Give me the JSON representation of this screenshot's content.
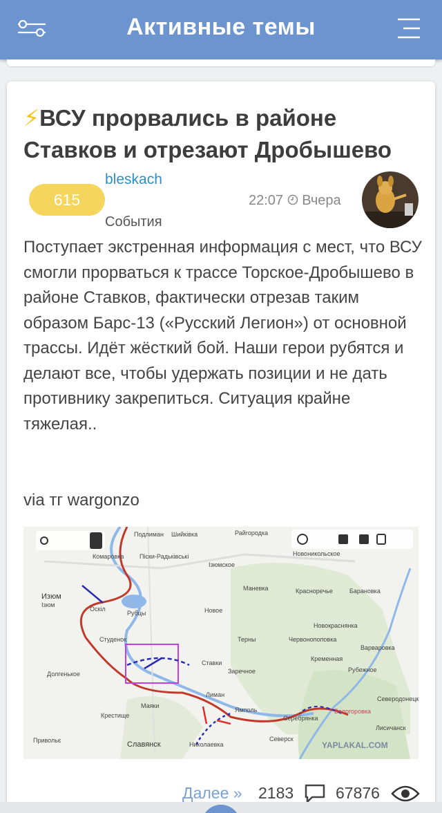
{
  "header": {
    "title": "Активные темы",
    "filter_icon": "filter-sliders-icon",
    "menu_icon": "hamburger-menu-icon"
  },
  "post": {
    "title_icon": "⚡",
    "title": "ВСУ прорвались в районе Ставков и отрезают Дробышево",
    "rating": "615",
    "author": "bleskach",
    "category": "События",
    "time": "22:07",
    "date": "Вчера",
    "body": "Поступает экстренная информация с мест, что ВСУ смогли прорваться к трассе Торское-Дробышево в районе Ставков, фактически отрезав таким образом Барс-13 («Русский Легион») от основной трассы. Идёт жёсткий бой. Наши герои рубятся и делают все, чтобы удержать позиции и не дать противнику закрепиться. Ситуация крайне тяжелая..",
    "via": "via тг wargonzo",
    "map": {
      "labels": [
        "Подлиман",
        "Шийківка",
        "Райгородка",
        "Комаровка",
        "Піски-Радьківські",
        "Ізюмское",
        "Новоникольское",
        "Изюм",
        "Ізюм",
        "Оскіл",
        "Рубцы",
        "Маневка",
        "Красноречье",
        "Барановка",
        "Новое",
        "Новокраснянка",
        "Студенок",
        "Терны",
        "Червонопоповка",
        "Варваровка",
        "Ставки",
        "Кременная",
        "Рубежное",
        "Долгенькое",
        "Заречное",
        "Лиман",
        "Ямполь",
        "Северодонецк",
        "Крестище",
        "Маяки",
        "Серебрянка",
        "Белогоровка",
        "Лисичанск",
        "Привольє",
        "Славянск",
        "Николаевка",
        "Северск"
      ],
      "watermark": "YAPLAKAL.COM"
    },
    "more_label": "Далее »",
    "comments": "2183",
    "views": "67876"
  },
  "colors": {
    "header_bg": "#6c95cf",
    "rating_bg": "#f6d55c",
    "author": "#2f8fc4",
    "link": "#7aa0d4"
  }
}
